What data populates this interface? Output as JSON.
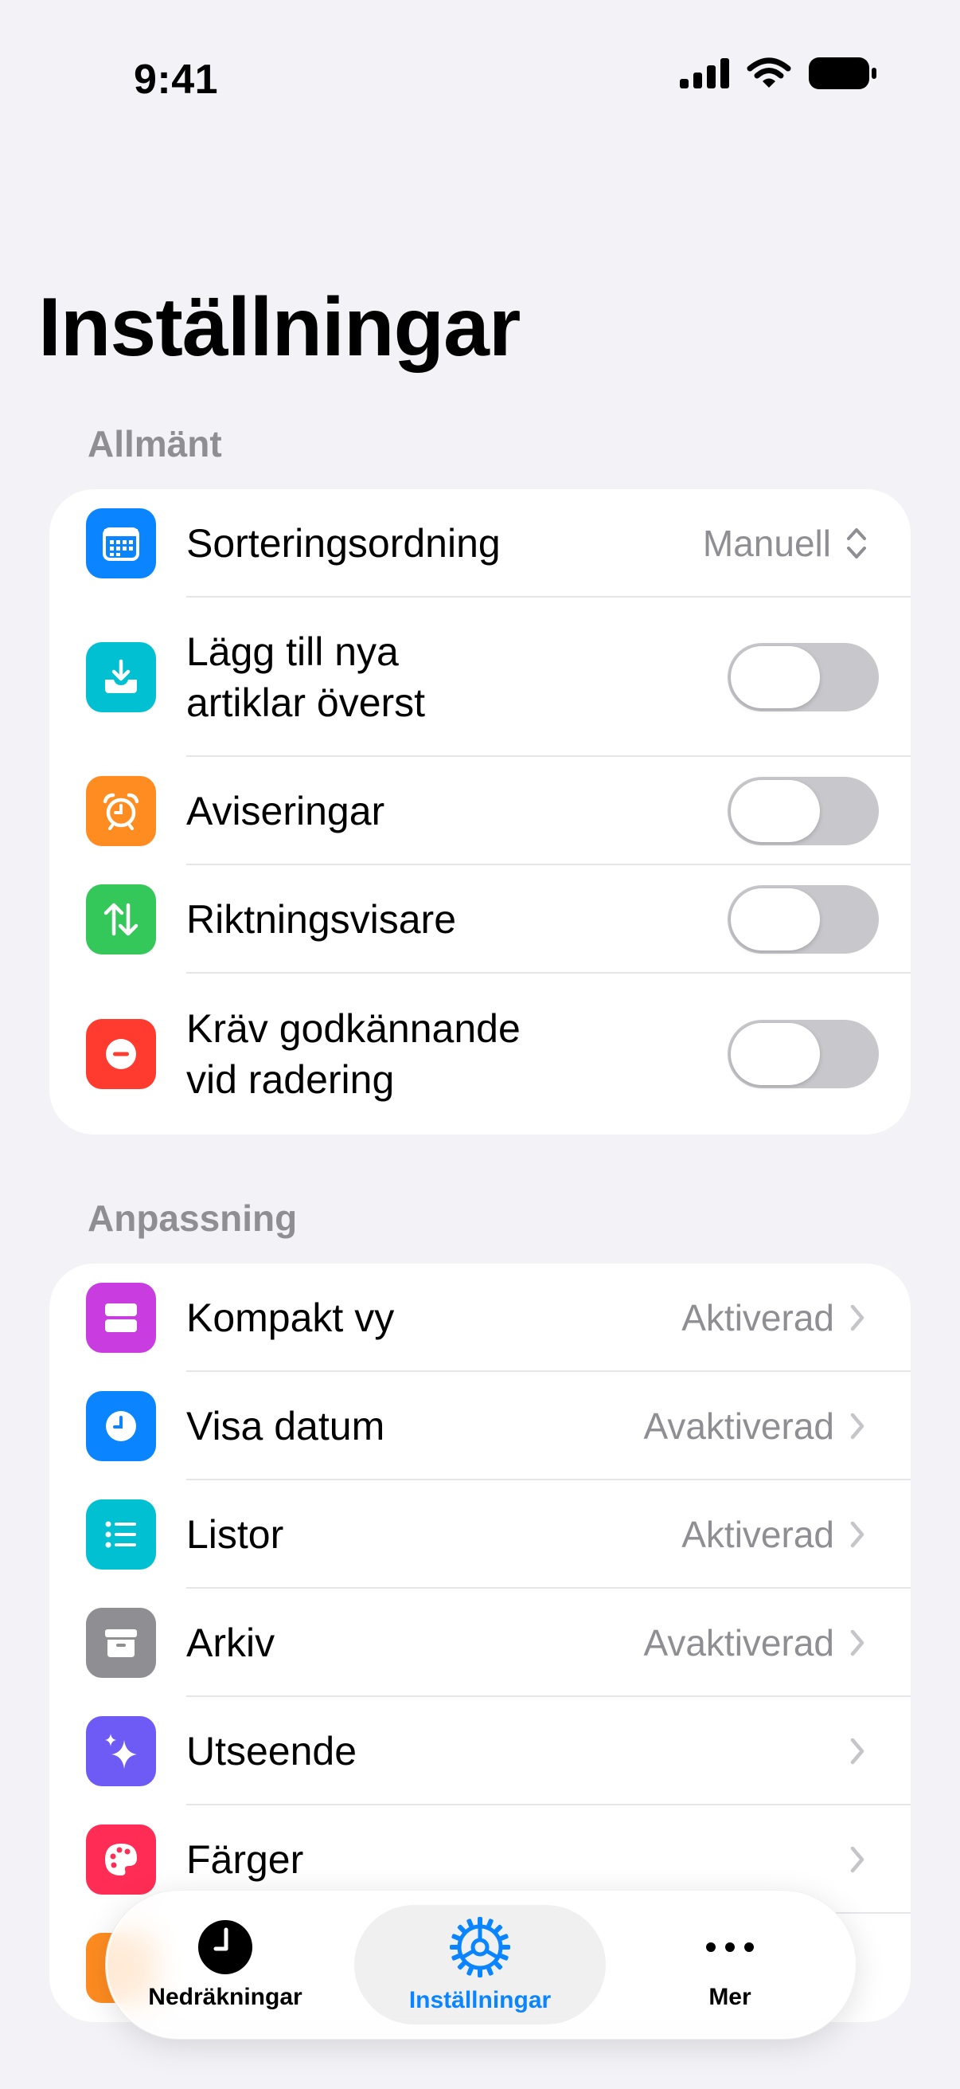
{
  "status": {
    "time": "9:41"
  },
  "title": "Inställningar",
  "sections": [
    {
      "header": "Allmänt",
      "rows": [
        {
          "label": "Sorteringsordning",
          "icon": "calendar-icon",
          "color": "#0A84FF",
          "value": "Manuell",
          "control": "popup"
        },
        {
          "label": "Lägg till nya\nartiklar överst",
          "icon": "tray-download-icon",
          "color": "#00C0D1",
          "control": "toggle",
          "on": false
        },
        {
          "label": "Aviseringar",
          "icon": "alarm-clock-icon",
          "color": "#FF8C21",
          "control": "toggle",
          "on": false
        },
        {
          "label": "Riktningsvisare",
          "icon": "arrows-up-down-icon",
          "color": "#34C759",
          "control": "toggle",
          "on": false
        },
        {
          "label": "Kräv godkännande\nvid radering",
          "icon": "minus-circle-icon",
          "color": "#FF3B30",
          "control": "toggle",
          "on": false
        }
      ]
    },
    {
      "header": "Anpassning",
      "rows": [
        {
          "label": "Kompakt vy",
          "icon": "compact-view-icon",
          "color": "#C83CE0",
          "value": "Aktiverad",
          "control": "chevron"
        },
        {
          "label": "Visa datum",
          "icon": "clock-icon",
          "color": "#0A84FF",
          "value": "Avaktiverad",
          "control": "chevron"
        },
        {
          "label": "Listor",
          "icon": "list-icon",
          "color": "#00C0D1",
          "value": "Aktiverad",
          "control": "chevron"
        },
        {
          "label": "Arkiv",
          "icon": "archive-box-icon",
          "color": "#8E8E93",
          "value": "Avaktiverad",
          "control": "chevron"
        },
        {
          "label": "Utseende",
          "icon": "sparkles-icon",
          "color": "#6E5BF5",
          "control": "chevron"
        },
        {
          "label": "Färger",
          "icon": "palette-icon",
          "color": "#FF2D55",
          "control": "chevron"
        }
      ]
    }
  ],
  "tabbar": {
    "tabs": [
      {
        "label": "Nedräkningar",
        "icon": "timer-clock-icon",
        "active": false
      },
      {
        "label": "Inställningar",
        "icon": "gear-icon",
        "active": true
      },
      {
        "label": "Mer",
        "icon": "more-dots-icon",
        "active": false
      }
    ]
  },
  "colors": {
    "accent": "#0A84FF",
    "background": "#F2F2F7"
  }
}
